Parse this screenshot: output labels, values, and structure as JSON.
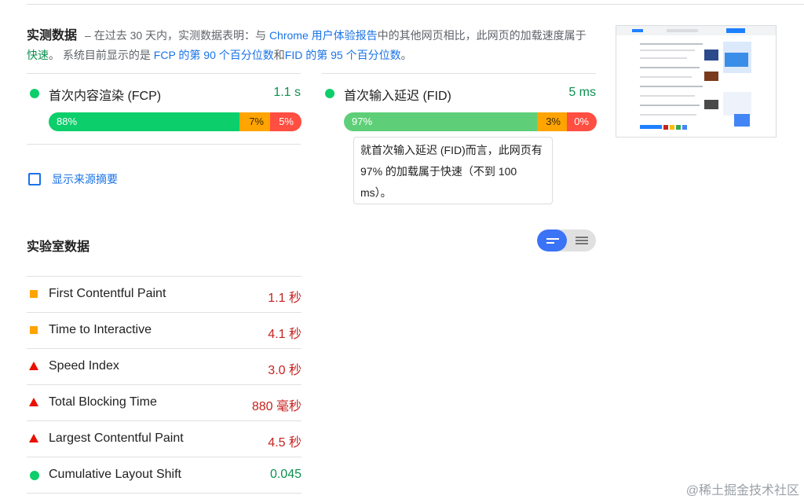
{
  "field": {
    "title": "实测数据",
    "desc_1": "– 在过去 30 天内，实测数据表明：与",
    "desc_link_chrome": "Chrome",
    "desc_link_report": "用户体验报告",
    "desc_2": "中的其他网页相比，此网页的加载速度属于",
    "desc_fast": "快速",
    "desc_3": "。 系统目前显示的是",
    "desc_fcp_pct": "FCP 的第 90 个百分位数",
    "desc_and": "和",
    "desc_fid_pct": "FID 的第 95 个百分位数",
    "desc_end": "。"
  },
  "metrics": [
    {
      "name": "首次内容渲染 (FCP)",
      "value": "1.1 s",
      "good": "88%",
      "average": "7%",
      "poor": "5%",
      "good_fraction": 0.88,
      "average_fraction": 0.07,
      "poor_fraction": 0.05
    },
    {
      "name": "首次输入延迟 (FID)",
      "value": "5 ms",
      "good": "97%",
      "average": "3%",
      "poor": "0%",
      "good_fraction": 0.97,
      "average_fraction": 0.03,
      "poor_fraction": 0.0
    }
  ],
  "tooltip": "就首次输入延迟 (FID)而言，此网页有97% 的加载属于快速（不到 100 ms）。",
  "origin_toggle": "显示来源摘要",
  "lab": {
    "title": "实验室数据",
    "rows": [
      {
        "name": "First Contentful Paint",
        "value": "1.1 秒",
        "status": "average",
        "color": "#c5221f"
      },
      {
        "name": "Time to Interactive",
        "value": "4.1 秒",
        "status": "average",
        "color": "#c5221f"
      },
      {
        "name": "Speed Index",
        "value": "3.0 秒",
        "status": "poor",
        "color": "#c5221f"
      },
      {
        "name": "Total Blocking Time",
        "value": "880 毫秒",
        "status": "poor",
        "color": "#c5221f"
      },
      {
        "name": "Largest Contentful Paint",
        "value": "4.5 秒",
        "status": "poor",
        "color": "#c5221f"
      },
      {
        "name": "Cumulative Layout Shift",
        "value": "0.045",
        "status": "good",
        "color": "#0d904f"
      }
    ]
  },
  "watermark": "@稀土掘金技术社区",
  "colors": {
    "good": "#0cce6b",
    "average": "#ffa400",
    "poor": "#ff4e42",
    "link": "#1a73e8",
    "toggle_active": "#3b73f6"
  }
}
